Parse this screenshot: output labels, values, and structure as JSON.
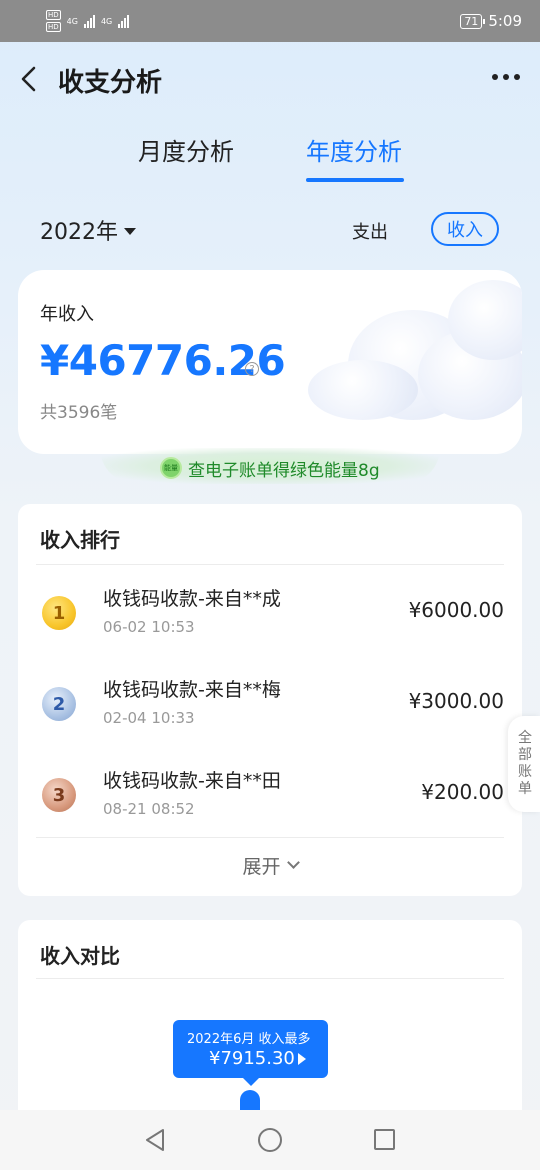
{
  "status_bar": {
    "hd1": "HD",
    "hd2": "HD",
    "net1": "4G",
    "net2": "4G",
    "battery": "71",
    "time": "5:09"
  },
  "header": {
    "title": "收支分析"
  },
  "tabs": [
    {
      "label": "月度分析",
      "active": false
    },
    {
      "label": "年度分析",
      "active": true
    }
  ],
  "filter": {
    "year": "2022年",
    "expense_label": "支出",
    "income_label": "收入"
  },
  "summary": {
    "label": "年收入",
    "amount": "¥46776.26",
    "info_symbol": "?",
    "count": "共3596笔"
  },
  "energy_banner": {
    "badge": "能量",
    "text": "查电子账单得绿色能量8g",
    "color": "#1f8a2a"
  },
  "ranking": {
    "title": "收入排行",
    "items": [
      {
        "rank": "1",
        "name": "收钱码收款-来自**成",
        "time": "06-02 10:53",
        "amount": "¥6000.00"
      },
      {
        "rank": "2",
        "name": "收钱码收款-来自**梅",
        "time": "02-04 10:33",
        "amount": "¥3000.00"
      },
      {
        "rank": "3",
        "name": "收钱码收款-来自**田",
        "time": "08-21 08:52",
        "amount": "¥200.00"
      }
    ],
    "expand_label": "展开"
  },
  "side_tab": {
    "chars": [
      "全",
      "部",
      "账",
      "单"
    ]
  },
  "comparison": {
    "title": "收入对比",
    "tooltip_title": "2022年6月 收入最多",
    "tooltip_value": "¥7915.30"
  },
  "colors": {
    "accent": "#1677ff",
    "green": "#1f8a2a"
  }
}
